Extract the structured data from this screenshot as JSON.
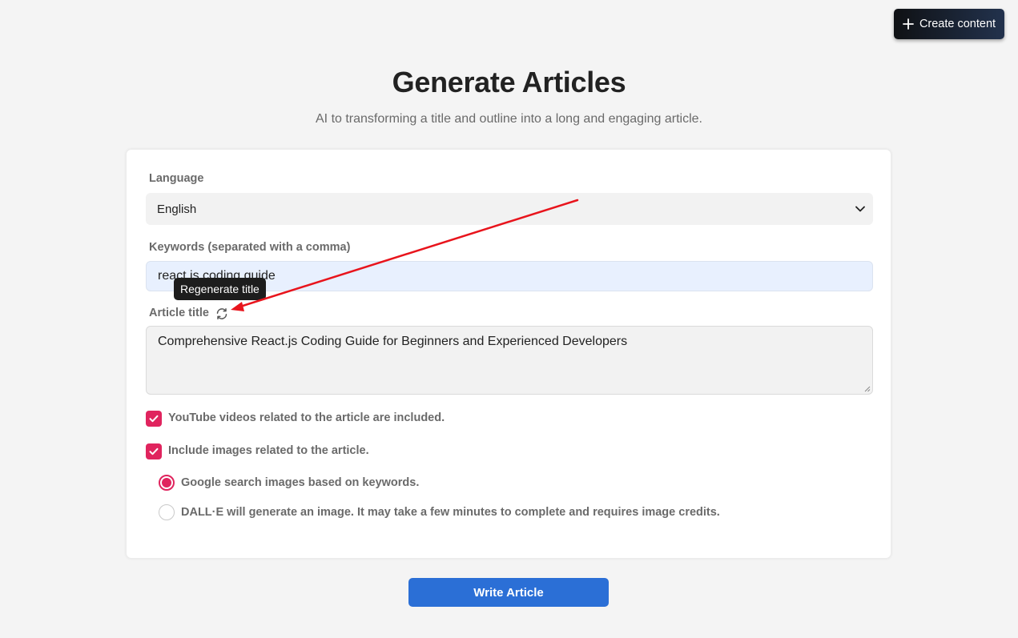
{
  "header": {
    "create_button_label": "Create content",
    "title": "Generate Articles",
    "subtitle": "AI to transforming a title and outline into a long and engaging article."
  },
  "form": {
    "language": {
      "label": "Language",
      "value": "English"
    },
    "keywords": {
      "label": "Keywords (separated with a comma)",
      "value": "react.js coding guide"
    },
    "article_title": {
      "label": "Article title",
      "tooltip": "Regenerate title",
      "value": "Comprehensive React.js Coding Guide for Beginners and Experienced Developers"
    },
    "options": {
      "youtube_label": "YouTube videos related to the article are included.",
      "youtube_checked": true,
      "images_label": "Include images related to the article.",
      "images_checked": true
    },
    "image_source": {
      "selected": "google",
      "google_label": "Google search images based on keywords.",
      "dalle_label": "DALL·E will generate an image. It may take a few minutes to complete and requires image credits."
    },
    "submit_label": "Write Article"
  },
  "icons": {
    "create": "plus-icon",
    "select": "chevron-down-icon",
    "regenerate": "refresh-icon",
    "checkbox": "check-icon"
  },
  "colors": {
    "accent_pink": "#e0245e",
    "primary_blue": "#2b6fd6",
    "annotation_red": "#e8141c"
  }
}
